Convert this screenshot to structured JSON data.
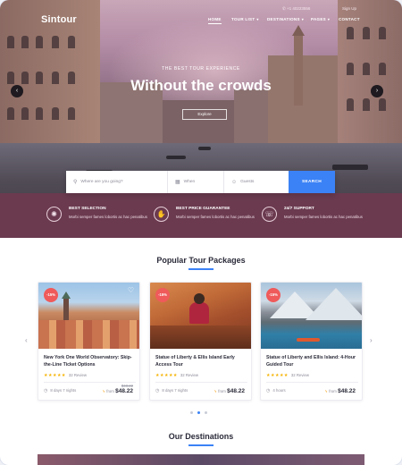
{
  "header": {
    "logo": "Sintour",
    "phone": "+1 40223556",
    "signup": "Sign Up",
    "nav": [
      {
        "label": "HOME",
        "dropdown": false
      },
      {
        "label": "TOUR LIST",
        "dropdown": true
      },
      {
        "label": "DESTINATIONS",
        "dropdown": true
      },
      {
        "label": "PAGES",
        "dropdown": true
      },
      {
        "label": "CONTACT",
        "dropdown": false
      }
    ]
  },
  "hero": {
    "eyebrow": "THE BEST TOUR EXPERIENCE",
    "headline": "Without the crowds",
    "button": "Explore"
  },
  "search": {
    "where_placeholder": "Where are you going?",
    "when_placeholder": "When",
    "guests_placeholder": "Guests",
    "button": "SEARCH"
  },
  "features": [
    {
      "title": "BEST SELECTION",
      "desc": "Morbi semper fames lobortis ac hac penatibus",
      "icon": "compass-icon"
    },
    {
      "title": "BEST PRICE GUARANTEE",
      "desc": "Morbi semper fames lobortis ac hac penatibus",
      "icon": "hand-money-icon"
    },
    {
      "title": "24/7 SUPPORT",
      "desc": "Morbi semper fames lobortis ac hac penatibus",
      "icon": "support-icon"
    }
  ],
  "packages": {
    "title": "Popular Tour Packages",
    "cards": [
      {
        "badge": "-15%",
        "title": "New York One World Observatory: Skip-the-Line Ticket Options",
        "stars": 5,
        "reviews": "32 Review",
        "duration": "8 days 7 nights",
        "old_price": "$48.22",
        "from": "from",
        "price": "$48.22"
      },
      {
        "badge": "-15%",
        "title": "Statue of Liberty & Ellis Island Early Access Tour",
        "stars": 5,
        "reviews": "32 Review",
        "duration": "8 days 7 nights",
        "old_price": "",
        "from": "from",
        "price": "$48.22"
      },
      {
        "badge": "-15%",
        "title": "Statue of Liberty and Ellis Island: 4-Hour Guided Tour",
        "stars": 5,
        "reviews": "32 Review",
        "duration": "4 hours",
        "old_price": "",
        "from": "from",
        "price": "$48.22"
      }
    ]
  },
  "destinations": {
    "title": "Our Destinations"
  },
  "colors": {
    "accent": "#3b82f6",
    "band": "#6b3a4f",
    "badge": "#ef5a5a",
    "star": "#f5b301"
  }
}
